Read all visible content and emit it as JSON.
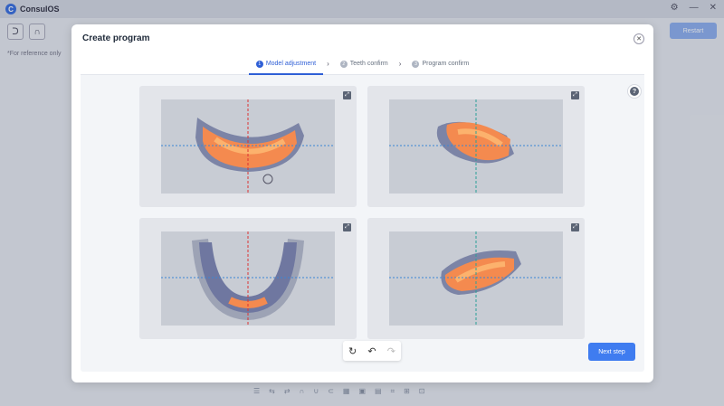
{
  "app": {
    "title": "ConsulOS",
    "logo_glyph": "C",
    "restart_label": "Restart",
    "reference_note": "*For reference only"
  },
  "dialog": {
    "title": "Create program",
    "close_glyph": "✕",
    "steps": [
      {
        "num": "1",
        "label": "Model adjustment",
        "active": true
      },
      {
        "num": "2",
        "label": "Teeth confirm",
        "active": false
      },
      {
        "num": "3",
        "label": "Program confirm",
        "active": false
      }
    ],
    "step_separator": "›",
    "help_glyph": "?",
    "next_label": "Next step",
    "tools": {
      "reset": "↻",
      "undo": "↶",
      "redo": "↷"
    },
    "expand_glyph": "⤢"
  },
  "colors": {
    "accent": "#3f7cf0",
    "axis_red": "#d33",
    "axis_blue": "#3a86d6",
    "tooth": "#f48a4f",
    "gum": "#7c84a6"
  }
}
